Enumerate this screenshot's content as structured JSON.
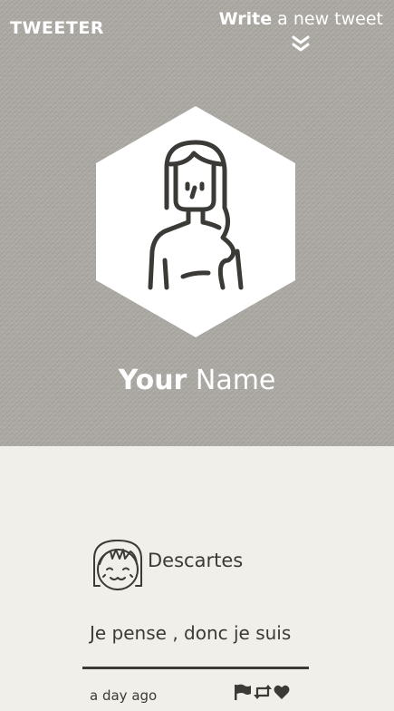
{
  "header": {
    "logo": "TWEETER",
    "write_strong": "Write",
    "write_rest": " a new tweet",
    "chevron_icon": "double-chevron-down-icon"
  },
  "profile": {
    "name_strong": "Your",
    "name_rest": " Name",
    "avatar_icon": "woman-avatar-icon"
  },
  "tweet": {
    "author": "Descartes",
    "avatar_icon": "girl-bangs-avatar-icon",
    "text": "Je pense , donc je suis",
    "time": "a day ago",
    "actions": [
      "flag-icon",
      "retweet-icon",
      "heart-icon"
    ]
  },
  "colors": {
    "hero_bg": "#aaa7a1",
    "page_bg": "#f1efe9",
    "ink": "#3b3a37",
    "white": "#ffffff"
  }
}
